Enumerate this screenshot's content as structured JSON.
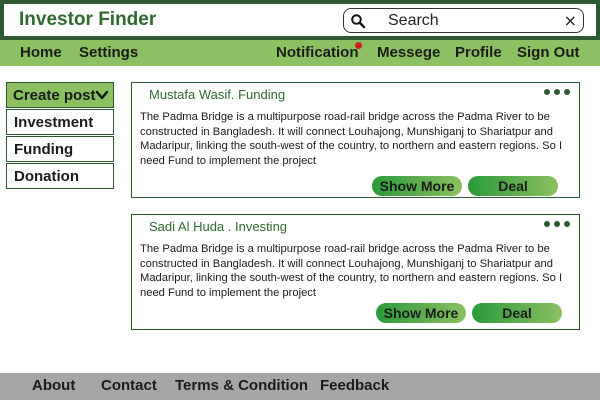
{
  "app": {
    "title": "Investor Finder"
  },
  "search": {
    "placeholder": "Search",
    "clear_symbol": "×"
  },
  "nav": {
    "home": "Home",
    "settings": "Settings",
    "notification": "Notification",
    "message": "Messege",
    "profile": "Profile",
    "sign_out": "Sign Out"
  },
  "sidebar": {
    "create_post": "Create post",
    "items": [
      "Investment",
      "Funding",
      "Donation"
    ]
  },
  "posts": [
    {
      "author": "Mustafa Wasif. Funding",
      "body": "The Padma Bridge is a multipurpose road-rail bridge across the Padma River to be constructed in Bangladesh. It will connect Louhajong, Munshiganj to Shariatpur and Madaripur, linking the south-west of the country, to northern and eastern regions. So I need Fund to implement the project",
      "show_more": "Show More",
      "deal": "Deal"
    },
    {
      "author": "Sadi Al Huda . Investing",
      "body": "The Padma Bridge is a multipurpose road-rail bridge across the Padma River to be constructed in Bangladesh. It will connect Louhajong, Munshiganj to Shariatpur and Madaripur, linking the south-west of the country, to northern and eastern regions. So I need Fund to implement the project",
      "show_more": "Show More",
      "deal": "Deal"
    }
  ],
  "footer": {
    "about": "About",
    "contact": "Contact",
    "terms": "Terms & Condition",
    "feedback": "Feedback"
  },
  "colors": {
    "brand_dark_green": "#2c5a2e",
    "nav_green": "#8cc062",
    "title_green": "#2f6b30",
    "notification_dot": "#d32020",
    "footer_gray": "#a6a6a6"
  },
  "icons": {
    "search": "search-icon",
    "clear": "close-icon",
    "dropdown": "chevron-down-icon",
    "post_menu": "more-icon",
    "notification_badge": "notification-dot"
  }
}
